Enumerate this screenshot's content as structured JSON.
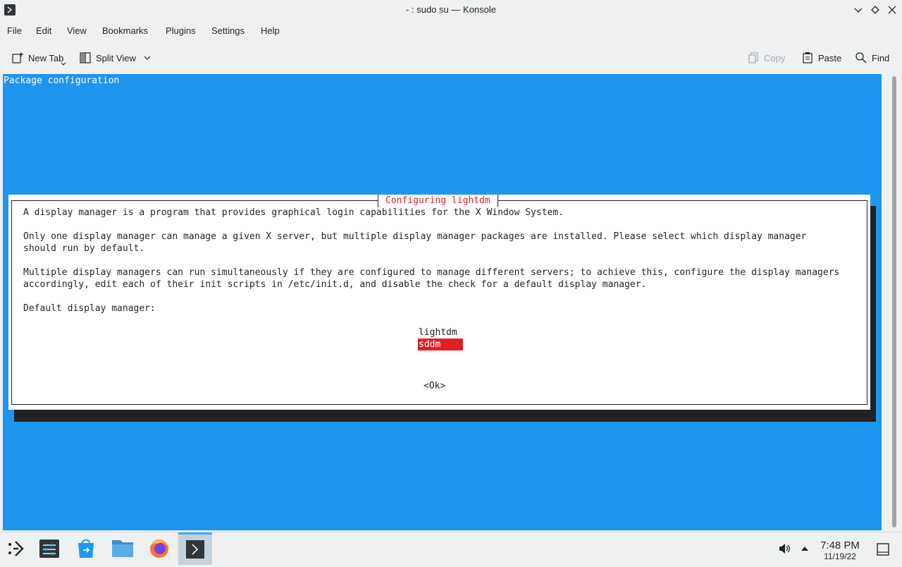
{
  "window": {
    "title": "- : sudo su — Konsole"
  },
  "menubar": {
    "items": [
      "File",
      "Edit",
      "View",
      "Bookmarks",
      "Plugins",
      "Settings",
      "Help"
    ]
  },
  "toolbar": {
    "new_tab": "New Tab",
    "split_view": "Split View",
    "copy": "Copy",
    "paste": "Paste",
    "find": "Find"
  },
  "terminal": {
    "header": "Package configuration",
    "dialog": {
      "title": "Configuring lightdm",
      "line1": "A display manager is a program that provides graphical login capabilities for the X Window System.",
      "line2": "Only one display manager can manage a given X server, but multiple display manager packages are installed. Please select which display manager",
      "line3": "should run by default.",
      "line4": "Multiple display managers can run simultaneously if they are configured to manage different servers; to achieve this, configure the display managers",
      "line5": "accordingly, edit each of their init scripts in /etc/init.d, and disable the check for a default display manager.",
      "line6": "Default display manager:",
      "options": [
        "lightdm",
        "sddm"
      ],
      "selected": "sddm",
      "ok": "<Ok>"
    }
  },
  "taskbar": {
    "apps": [
      "application-launcher-icon",
      "system-settings-icon",
      "discover-icon",
      "file-manager-icon",
      "firefox-icon",
      "konsole-icon"
    ],
    "clock_time": "7:48 PM",
    "clock_date": "11/19/22"
  },
  "colors": {
    "terminal_bg": "#1e96f0",
    "selection_red": "#e31f25",
    "accent": "#3daee9"
  }
}
